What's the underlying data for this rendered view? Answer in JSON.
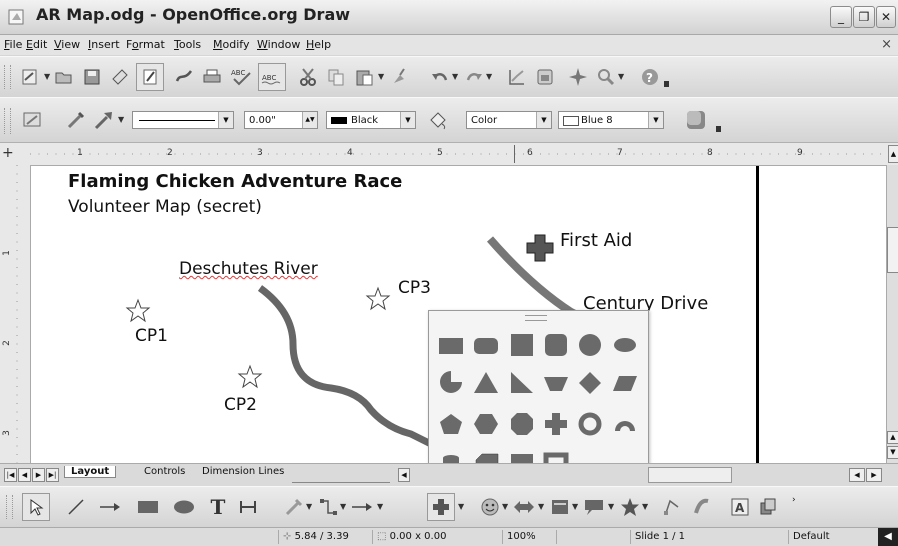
{
  "window": {
    "title": "AR Map.odg - OpenOffice.org Draw",
    "buttons": {
      "minimize": "_",
      "maximize": "❐",
      "close": "✕"
    }
  },
  "menubar": {
    "items": [
      {
        "label": "File",
        "u": "F",
        "rest": "ile"
      },
      {
        "label": "Edit",
        "u": "E",
        "rest": "dit"
      },
      {
        "label": "View",
        "u": "V",
        "rest": "iew"
      },
      {
        "label": "Insert",
        "u": "I",
        "rest": "nsert"
      },
      {
        "label": "Format",
        "pre": "F",
        "u": "o",
        "rest": "rmat"
      },
      {
        "label": "Tools",
        "u": "T",
        "rest": "ools"
      },
      {
        "label": "Modify",
        "u": "M",
        "rest": "odify"
      },
      {
        "label": "Window",
        "u": "W",
        "rest": "indow"
      },
      {
        "label": "Help",
        "u": "H",
        "rest": "elp"
      }
    ],
    "close": "×"
  },
  "line_toolbar": {
    "line_width": "0.00\"",
    "line_color": "Black",
    "area_style": "Color",
    "area_color": "Blue 8"
  },
  "ruler": {
    "h_numbers": [
      "1",
      "2",
      "3",
      "4",
      "5",
      "6",
      "7",
      "8",
      "9"
    ],
    "v_numbers": [
      "1",
      "2",
      "3"
    ]
  },
  "map": {
    "title": "Flaming Chicken Adventure Race",
    "subtitle": "Volunteer Map (secret)",
    "first_aid": "First Aid",
    "river": "Deschutes River",
    "road": "Century Drive",
    "checkpoints": [
      "CP1",
      "CP2",
      "CP3"
    ],
    "road_color": "#777777",
    "river_color": "#666666"
  },
  "tabs": [
    "Layout",
    "Controls",
    "Dimension Lines"
  ],
  "statusbar": {
    "position": "5.84 / 3.39",
    "size": "0.00 x 0.00",
    "zoom": "100%",
    "slide": "Slide 1 / 1",
    "layout": "Default"
  },
  "icons": {
    "accent": "#707070"
  }
}
